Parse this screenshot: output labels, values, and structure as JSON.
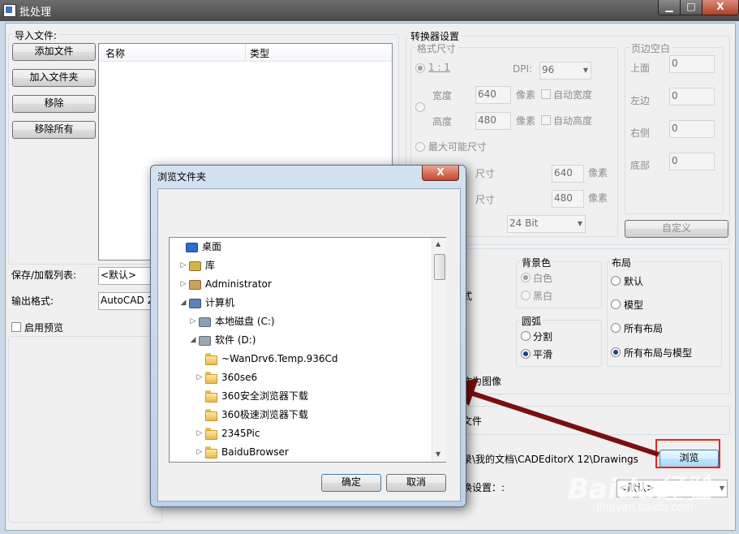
{
  "window": {
    "title": "批处理",
    "min_label": "▁",
    "max_label": "□",
    "close_label": "X"
  },
  "import": {
    "group_label": "导入文件:",
    "add_file": "添加文件",
    "add_folder": "加入文件夹",
    "remove": "移除",
    "remove_all": "移除所有",
    "columns": [
      "名称",
      "类型"
    ]
  },
  "bottom_left": {
    "save_list_label": "保存/加载列表:",
    "save_list_value": "<默认>",
    "output_format_label": "输出格式:",
    "output_format_value": "AutoCAD 2",
    "enable_preview": "启用预览"
  },
  "converter": {
    "group_label": "转换器设置",
    "format_size_label": "格式尺寸",
    "ratio_label": "1 : 1",
    "dpi_label": "DPI:",
    "dpi_value": "96",
    "width_label": "宽度",
    "width_value": "640",
    "height_label": "高度",
    "height_value": "480",
    "pixel_unit": "像素",
    "auto_width": "自动宽度",
    "auto_height": "自动高度",
    "max_size": "最大可能尺寸",
    "size_a_label": "尺寸",
    "size_a_value": "640",
    "size_b_label": "尺寸",
    "size_b_value": "480",
    "bit_value": "24 Bit",
    "margins_label": "页边空白",
    "margin_top": "上面",
    "margin_left": "左边",
    "margin_right": "右侧",
    "margin_bottom": "底部",
    "margin_value": "0",
    "custom_button": "自定义"
  },
  "options": {
    "mode_fragment": "式",
    "background_label": "背景色",
    "bg_white": "白色",
    "bg_black": "黑白",
    "arc_label": "圆弧",
    "arc_split": "分割",
    "arc_smooth": "平滑",
    "layout_label": "布局",
    "layout_default": "默认",
    "layout_model": "模型",
    "layout_all": "所有布局",
    "layout_all_model": "所有布局与模型",
    "as_image": "作为图像",
    "file_fragment": "文件",
    "path_value": "录\\我的文档\\CADEditorX 12\\Drawings",
    "browse_button": "浏览",
    "convert_settings_label": "换设置：:",
    "convert_settings_value": "<默认>"
  },
  "dialog": {
    "title": "浏览文件夹",
    "close_label": "X",
    "tree": [
      {
        "label": "桌面",
        "icon": "desktop-icon",
        "level": 0,
        "toggle": ""
      },
      {
        "label": "库",
        "icon": "library-icon",
        "level": 1,
        "toggle": "▷"
      },
      {
        "label": "Administrator",
        "icon": "user-folder-icon",
        "level": 1,
        "toggle": "▷"
      },
      {
        "label": "计算机",
        "icon": "computer-icon",
        "level": 1,
        "toggle": "◢"
      },
      {
        "label": "本地磁盘 (C:)",
        "icon": "drive-c-icon",
        "level": 2,
        "toggle": "▷"
      },
      {
        "label": "软件 (D:)",
        "icon": "drive-d-icon",
        "level": 2,
        "toggle": "◢"
      },
      {
        "label": "~WanDrv6.Temp.936Cd",
        "icon": "folder-icon",
        "level": 3,
        "toggle": ""
      },
      {
        "label": "360se6",
        "icon": "folder-icon",
        "level": 3,
        "toggle": "▷"
      },
      {
        "label": "360安全浏览器下载",
        "icon": "folder-icon",
        "level": 3,
        "toggle": ""
      },
      {
        "label": "360极速浏览器下载",
        "icon": "folder-icon",
        "level": 3,
        "toggle": ""
      },
      {
        "label": "2345Pic",
        "icon": "folder-icon",
        "level": 3,
        "toggle": "▷"
      },
      {
        "label": "BaiduBrowser",
        "icon": "folder-icon",
        "level": 3,
        "toggle": "▷"
      }
    ],
    "ok_button": "确定",
    "cancel_button": "取消"
  },
  "watermark": {
    "brand": "Baidu经验",
    "url": "jingyan.baidu.com"
  },
  "colors": {
    "highlight": "#e22222",
    "arrow": "#7a0f0f"
  }
}
